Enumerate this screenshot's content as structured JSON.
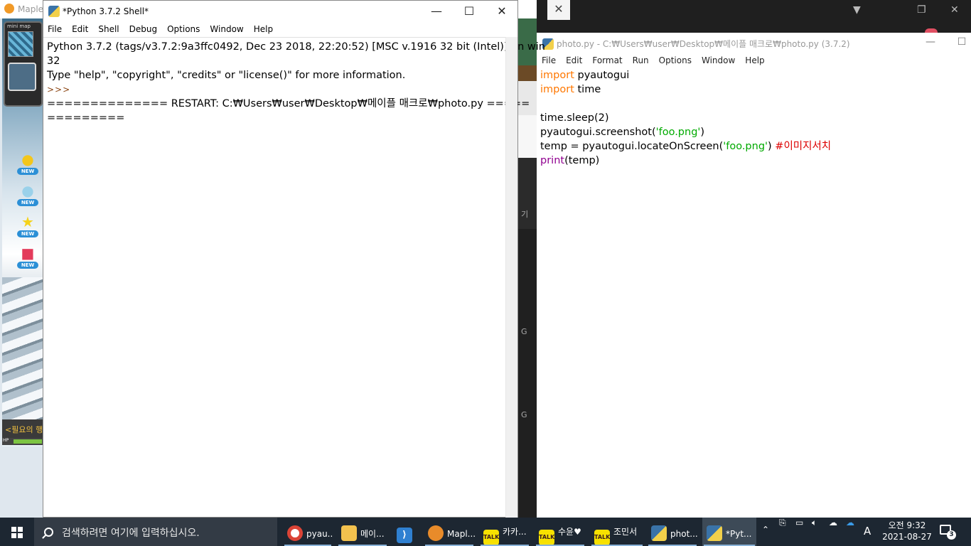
{
  "background": {
    "game_window": {
      "title": "Maple",
      "minimap_label": "mini map",
      "badge_text": "NEW",
      "chat_text": "<필요의 행",
      "hp_label": "HP"
    },
    "mid_strip_texts": [
      "기",
      "G",
      "G"
    ]
  },
  "editor": {
    "title": "photo.py - C:₩Users₩user₩Desktop₩메이플 매크로₩photo.py (3.7.2)",
    "menu": [
      "File",
      "Edit",
      "Format",
      "Run",
      "Options",
      "Window",
      "Help"
    ],
    "code_lines": [
      {
        "kw": "import",
        "rest": " pyautogui"
      },
      {
        "kw": "import",
        "rest": " time"
      },
      {
        "text": ""
      },
      {
        "text": "time.sleep(2)"
      },
      {
        "pre": "pyautogui.screenshot(",
        "str": "'foo.png'",
        "post": ")"
      },
      {
        "pre": "temp = pyautogui.locateOnScreen(",
        "str": "'foo.png'",
        "post": ") ",
        "comment": "#이미지서치"
      },
      {
        "builtin": "print",
        "rest": "(temp)"
      }
    ]
  },
  "shell": {
    "title": "*Python 3.7.2 Shell*",
    "menu": [
      "File",
      "Edit",
      "Shell",
      "Debug",
      "Options",
      "Window",
      "Help"
    ],
    "lines": [
      "Python 3.7.2 (tags/v3.7.2:9a3ffc0492, Dec 23 2018, 22:20:52) [MSC v.1916 32 bit (Intel)] on win",
      "32",
      "Type \"help\", \"copyright\", \"credits\" or \"license()\" for more information."
    ],
    "prompt": ">>>",
    "restart_line_1": "============== RESTART: C:₩Users₩user₩Desktop₩메이플 매크로₩photo.py =====",
    "restart_line_2": "========="
  },
  "taskbar": {
    "search_placeholder": "검색하려면 여기에 입력하십시오.",
    "apps": [
      {
        "label": "pyau...",
        "icon": "chrome-icon",
        "color": "#db4437"
      },
      {
        "label": "메이...",
        "icon": "folder-icon",
        "color": "#f2c14e"
      },
      {
        "label": "",
        "icon": "vscode-icon",
        "color": "#2f80d1"
      },
      {
        "label": "Mapl...",
        "icon": "maplestory-icon",
        "color": "#e88b2a"
      },
      {
        "label": "카카...",
        "icon": "kakaotalk-icon",
        "color": "#f7e100"
      },
      {
        "label": "수윤♥",
        "icon": "kakaotalk-icon",
        "color": "#f7e100"
      },
      {
        "label": "조민서",
        "icon": "kakaotalk-icon",
        "color": "#f7e100"
      },
      {
        "label": "phot...",
        "icon": "python-idle-icon",
        "color": "#3a73a8"
      },
      {
        "label": "*Pyt...",
        "icon": "python-idle-icon",
        "color": "#3a73a8"
      }
    ],
    "kakao_badge": "TALK",
    "ime_indicator": "A",
    "time": "오전 9:32",
    "date": "2021-08-27",
    "notification_count": "3"
  }
}
